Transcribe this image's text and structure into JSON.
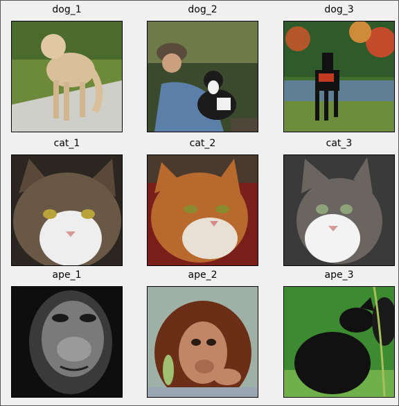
{
  "window": {
    "type": "figure"
  },
  "grid": {
    "rows": 3,
    "cols": 3,
    "cells": [
      {
        "title": "dog_1",
        "subject": "beige poodle-mix dog on park path",
        "colors": [
          "#6d8a3a",
          "#cfcfc9",
          "#d9c09a"
        ]
      },
      {
        "title": "dog_2",
        "subject": "man in hat holding black and white dog",
        "colors": [
          "#3b4a2c",
          "#5b7fa8",
          "#1b1b1b"
        ]
      },
      {
        "title": "dog_3",
        "subject": "black dog with red bandana by lake",
        "colors": [
          "#b3572a",
          "#3f6e2f",
          "#111111"
        ]
      },
      {
        "title": "cat_1",
        "subject": "calico cat face close-up",
        "colors": [
          "#5a4838",
          "#eeeeee",
          "#2b2620"
        ]
      },
      {
        "title": "cat_2",
        "subject": "orange and white cat face",
        "colors": [
          "#b86a2e",
          "#e8e0d5",
          "#7a1f1a"
        ]
      },
      {
        "title": "cat_3",
        "subject": "tabby and white cat face",
        "colors": [
          "#6b6561",
          "#f3f3f3",
          "#3a3a3a"
        ]
      },
      {
        "title": "ape_1",
        "subject": "grayscale chimpanzee portrait",
        "colors": [
          "#0e0e0e",
          "#9a9a9a",
          "#3a3a3a"
        ]
      },
      {
        "title": "ape_2",
        "subject": "baby orangutan holding leaf",
        "colors": [
          "#6b2f18",
          "#c08666",
          "#9fc070"
        ]
      },
      {
        "title": "ape_3",
        "subject": "black macaque on grass",
        "colors": [
          "#3d8b30",
          "#111111",
          "#6fb04a"
        ]
      }
    ]
  }
}
